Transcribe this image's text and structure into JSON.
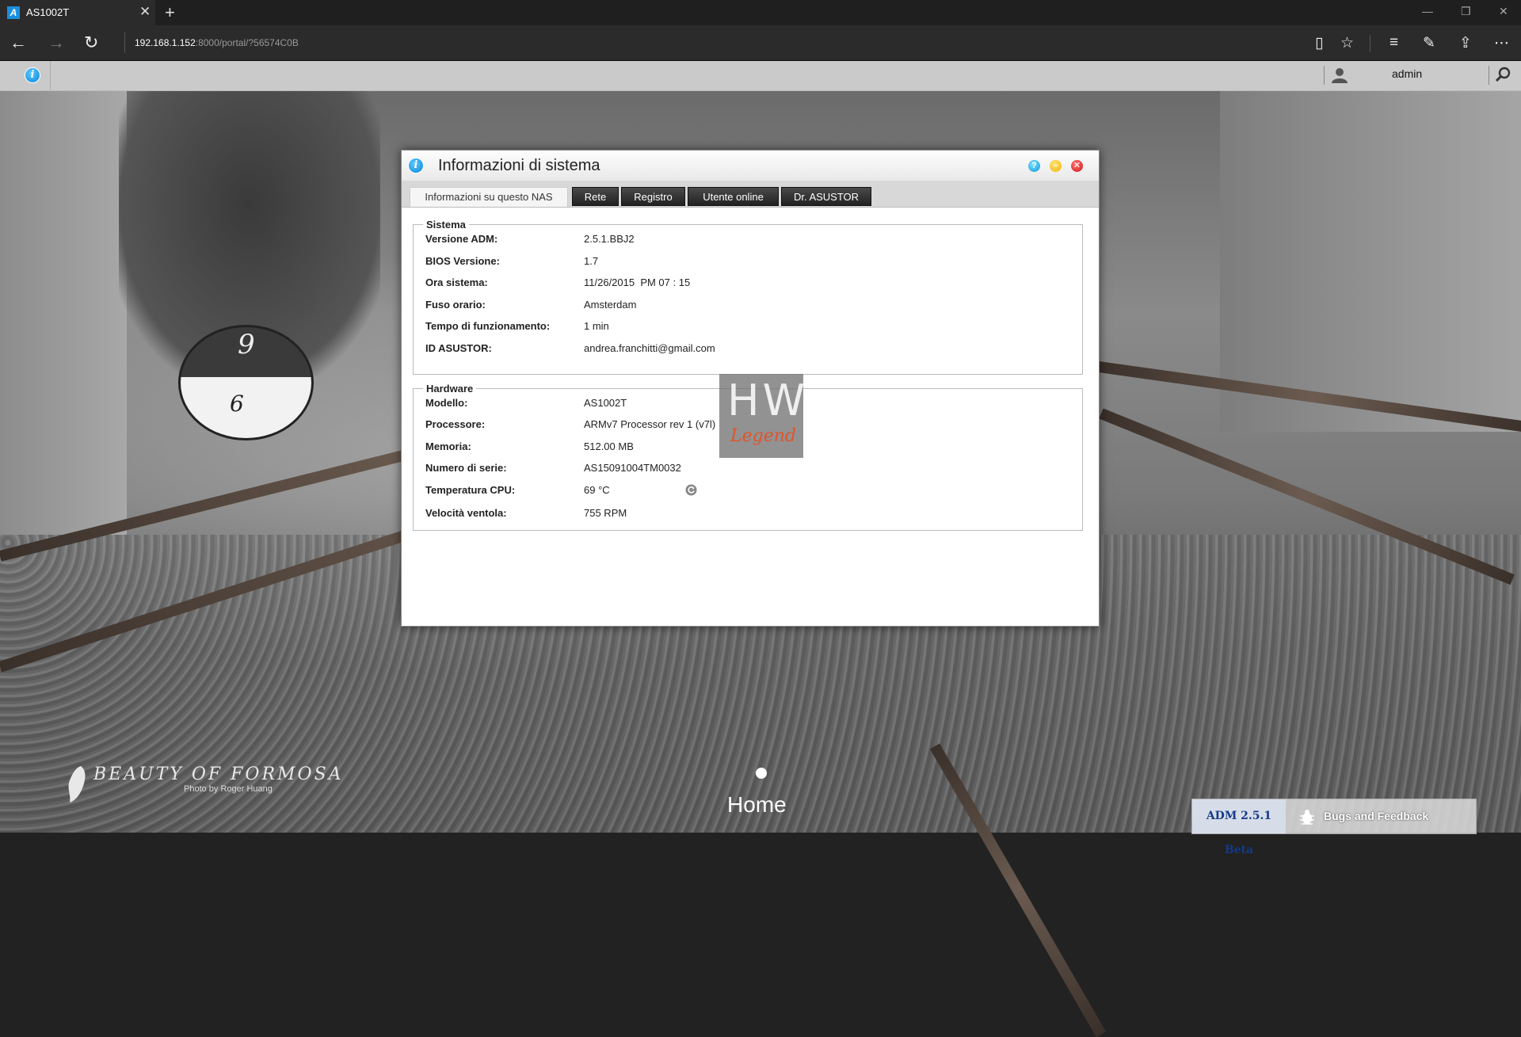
{
  "browser": {
    "tab_title": "AS1002T",
    "favicon_letter": "A",
    "url_host": "192.168.1.152",
    "url_rest": ":8000/portal/?56574C0B"
  },
  "adm": {
    "username": "admin"
  },
  "window": {
    "title": "Informazioni di sistema",
    "tabs": [
      {
        "label": "Informazioni su questo NAS",
        "active": true
      },
      {
        "label": "Rete",
        "active": false
      },
      {
        "label": "Registro",
        "active": false
      },
      {
        "label": "Utente online",
        "active": false
      },
      {
        "label": "Dr. ASUSTOR",
        "active": false
      }
    ],
    "system": {
      "legend": "Sistema",
      "rows": [
        {
          "label": "Versione ADM:",
          "value": "2.5.1.BBJ2"
        },
        {
          "label": "BIOS Versione:",
          "value": "1.7"
        },
        {
          "label": "Ora sistema:",
          "value": "11/26/2015  PM 07 : 15"
        },
        {
          "label": "Fuso orario:",
          "value": "Amsterdam"
        },
        {
          "label": "Tempo di funzionamento:",
          "value": "1 min"
        },
        {
          "label": "ID ASUSTOR:",
          "value": "andrea.franchitti@gmail.com"
        }
      ]
    },
    "hardware": {
      "legend": "Hardware",
      "rows": [
        {
          "label": "Modello:",
          "value": "AS1002T"
        },
        {
          "label": "Processore:",
          "value": "ARMv7 Processor rev 1 (v7l)"
        },
        {
          "label": "Memoria:",
          "value": "512.00 MB"
        },
        {
          "label": "Numero di serie:",
          "value": "AS15091004TM0032"
        },
        {
          "label": "Temperatura CPU:",
          "value": "69 °C"
        },
        {
          "label": "Velocità ventola:",
          "value": "755 RPM"
        }
      ]
    }
  },
  "wallpaper": {
    "brand": "BEAUTY OF FORMOSA",
    "credit": "Photo by Roger Huang",
    "signal_top": "9",
    "signal_bottom": "6"
  },
  "watermark": {
    "top": "HW",
    "bottom": "Legend"
  },
  "desktop": {
    "home_label": "Home"
  },
  "statusbar": {
    "version": "ADM 2.5.1 Beta",
    "bugs": "Bugs and Feedback"
  }
}
